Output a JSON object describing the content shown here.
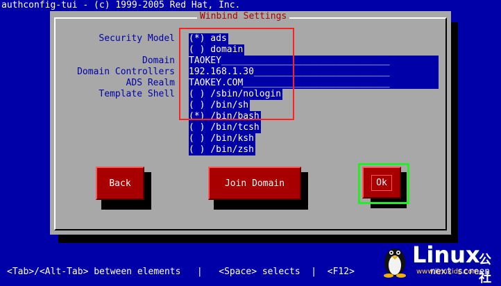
{
  "app": {
    "header": "authconfig-tui - (c) 1999-2005 Red Hat, Inc."
  },
  "dialog": {
    "title": "Winbind Settings",
    "labels": {
      "security_model": "Security Model",
      "domain": "Domain",
      "domain_controllers": "Domain Controllers",
      "ads_realm": "ADS Realm",
      "template_shell": "Template Shell"
    },
    "security_model_options": [
      {
        "text": "(*) ads",
        "selected": true
      },
      {
        "text": "( ) domain",
        "selected": false
      }
    ],
    "fields": {
      "domain": "TAOKEY_______________________________",
      "domain_controllers": "192.168.1.30_________________________",
      "ads_realm": "TAOKEY.COM___________________________"
    },
    "template_shell_options": [
      {
        "text": "( ) /sbin/nologin",
        "selected": false
      },
      {
        "text": "( ) /bin/sh",
        "selected": false
      },
      {
        "text": "(*) /bin/bash",
        "selected": true
      },
      {
        "text": "( ) /bin/tcsh",
        "selected": false
      },
      {
        "text": "( ) /bin/ksh",
        "selected": false
      },
      {
        "text": "( ) /bin/zsh",
        "selected": false
      }
    ],
    "buttons": {
      "back": "Back",
      "join_domain": "Join Domain",
      "ok": "Ok"
    }
  },
  "footer": {
    "hint": "<Tab>/<Alt-Tab> between elements   |   <Space> selects  |  <F12>",
    "tail": "next screen"
  },
  "watermark": {
    "brand": "Linux",
    "brand_cn": "公社",
    "url": "www.linuxidc.com"
  },
  "colors": {
    "background": "#0000a8",
    "dialog": "#a8a8a8",
    "button": "#a80000",
    "highlight_red": "#ff2020",
    "highlight_green": "#22ee22"
  }
}
